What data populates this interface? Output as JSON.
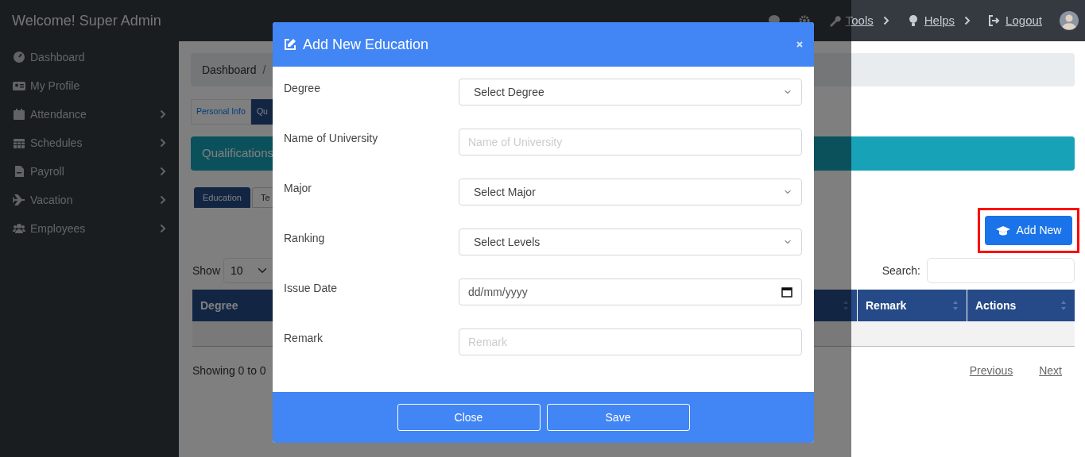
{
  "navbar": {
    "title": "Welcome! Super Admin",
    "menu": [
      {
        "label": "Tools",
        "dropdown": true
      },
      {
        "label": "Helps",
        "dropdown": true
      },
      {
        "label": "Logout",
        "dropdown": false
      }
    ]
  },
  "sidebar": {
    "items": [
      {
        "label": "Dashboard",
        "expandable": false
      },
      {
        "label": "My Profile",
        "expandable": false
      },
      {
        "label": "Attendance",
        "expandable": true
      },
      {
        "label": "Schedules",
        "expandable": true
      },
      {
        "label": "Payroll",
        "expandable": true
      },
      {
        "label": "Vacation",
        "expandable": true
      },
      {
        "label": "Employees",
        "expandable": true
      }
    ]
  },
  "breadcrumb": {
    "items": [
      "Dashboard"
    ],
    "separator": "/"
  },
  "tabs": [
    {
      "label": "Personal Info",
      "selected": false
    },
    {
      "label": "Qu",
      "selected": true
    }
  ],
  "section_title": "Qualifications",
  "subtabs": [
    {
      "label": "Education",
      "selected": true
    },
    {
      "label": "Te",
      "selected": false
    }
  ],
  "add_button": "Add New",
  "table": {
    "length_label": "Show",
    "length_value": "10",
    "search_label": "Search:",
    "columns": [
      {
        "label": "Degree"
      },
      {
        "label": "Remark"
      },
      {
        "label": "Actions"
      }
    ],
    "info": "Showing 0 to 0",
    "pager": [
      "Previous",
      "Next"
    ]
  },
  "modal": {
    "title": "Add New Education",
    "fields": [
      {
        "label": "Degree",
        "kind": "select",
        "value": "Select Degree"
      },
      {
        "label": "Name of University",
        "kind": "text",
        "placeholder": "Name of University"
      },
      {
        "label": "Major",
        "kind": "select",
        "value": "Select Major"
      },
      {
        "label": "Ranking",
        "kind": "select",
        "value": "Select Levels"
      },
      {
        "label": "Issue Date",
        "kind": "date",
        "placeholder": "dd/mm/yyyy"
      },
      {
        "label": "Remark",
        "kind": "text",
        "placeholder": "Remark"
      }
    ],
    "buttons": [
      "Close",
      "Save"
    ]
  }
}
